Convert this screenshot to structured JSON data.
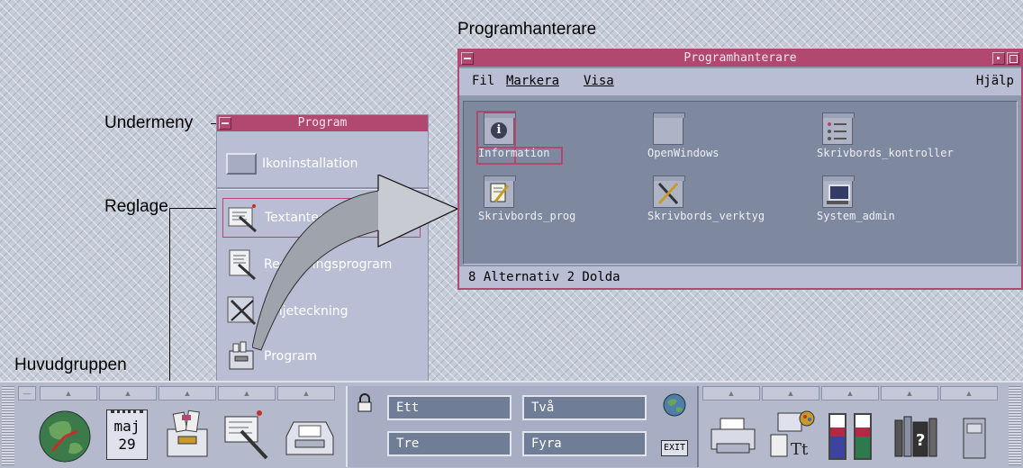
{
  "callouts": {
    "appmgr": "Programhanterare",
    "submenu": "Undermeny",
    "control": "Reglage",
    "maingroup": "Huvudgruppen"
  },
  "subpanel": {
    "title": "Program",
    "items": [
      {
        "label": "Ikoninstallation",
        "icon": "icon-installer-icon"
      },
      {
        "label": "Textanteckning",
        "icon": "text-note-icon"
      },
      {
        "label": "Redigeringsprogram",
        "icon": "text-editor-icon"
      },
      {
        "label": "Linjeteckning",
        "icon": "line-drawing-icon"
      },
      {
        "label": "Program",
        "icon": "program-drawer-icon"
      }
    ]
  },
  "app_manager": {
    "title": "Programhanterare",
    "menu": {
      "file": "Fil",
      "select": "Markera",
      "view": "Visa",
      "help": "Hjälp"
    },
    "icons": [
      {
        "label": "Information",
        "icon": "information-icon"
      },
      {
        "label": "OpenWindows",
        "icon": "folder-icon"
      },
      {
        "label": "Skrivbords_kontroller",
        "icon": "desktop-controls-icon"
      },
      {
        "label": "Skrivbords_prog",
        "icon": "desktop-apps-icon"
      },
      {
        "label": "Skrivbords_verktyg",
        "icon": "desktop-tools-icon"
      },
      {
        "label": "System_admin",
        "icon": "system-admin-icon"
      }
    ],
    "status": "8 Alternativ 2 Dolda"
  },
  "front_panel": {
    "calendar_month": "maj",
    "calendar_day": "29",
    "workspaces": [
      "Ett",
      "Två",
      "Tre",
      "Fyra"
    ],
    "exit_label": "EXIT",
    "colors": {
      "accent": "#b0486f",
      "workspace": "#6f7d97"
    }
  }
}
